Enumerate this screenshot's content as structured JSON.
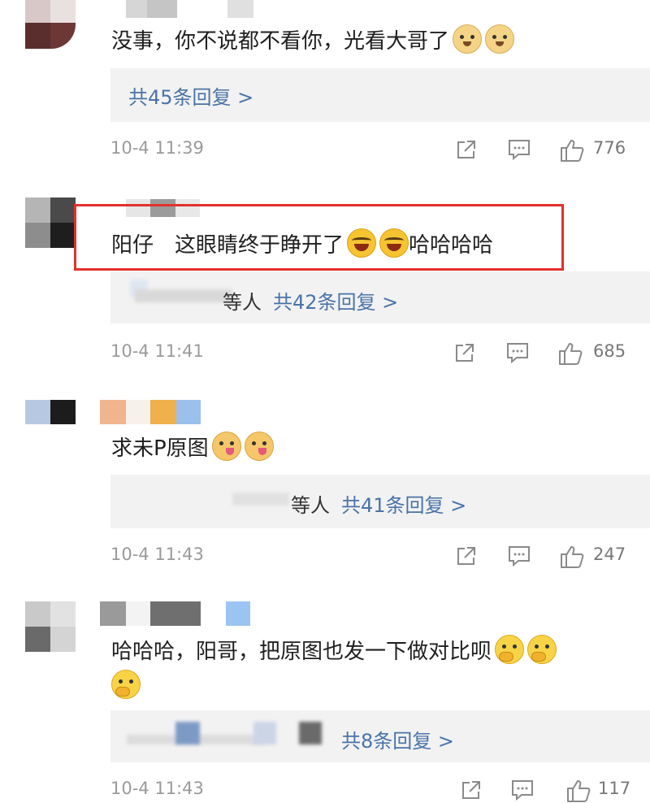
{
  "comments": [
    {
      "text": "没事，你不说都不看你，光看大哥了",
      "emojis": [
        "doge-emoji",
        "doge-emoji"
      ],
      "reply_prefix": "",
      "reply_count_text": "共45条回复 >",
      "timestamp": "10-4 11:39",
      "likes": "776"
    },
    {
      "text": "阳仔　这眼睛终于睁开了",
      "emojis": [
        "laugh-cry-emoji",
        "laugh-cry-emoji"
      ],
      "text_suffix": "哈哈哈哈",
      "reply_prefix": "等人",
      "reply_count_text": "共42条回复 >",
      "timestamp": "10-4 11:41",
      "likes": "685"
    },
    {
      "text": "求未P原图",
      "emojis": [
        "drool-emoji",
        "drool-emoji"
      ],
      "reply_prefix": "等人",
      "reply_count_text": "共41条回复 >",
      "timestamp": "10-4 11:43",
      "likes": "247"
    },
    {
      "text": "哈哈哈，阳哥，把原图也发一下做对比呗",
      "emojis": [
        "thinking-emoji",
        "thinking-emoji",
        "thinking-emoji"
      ],
      "reply_prefix": "",
      "reply_count_text": "共8条回复 >",
      "timestamp": "10-4 11:43",
      "likes": "117"
    }
  ],
  "icons": {
    "share": "share-icon",
    "comment": "comment-icon",
    "like": "thumbs-up-icon"
  },
  "colors": {
    "highlight": "#e2312d",
    "link": "#4a73a8",
    "reply_bg": "#f2f2f2"
  }
}
